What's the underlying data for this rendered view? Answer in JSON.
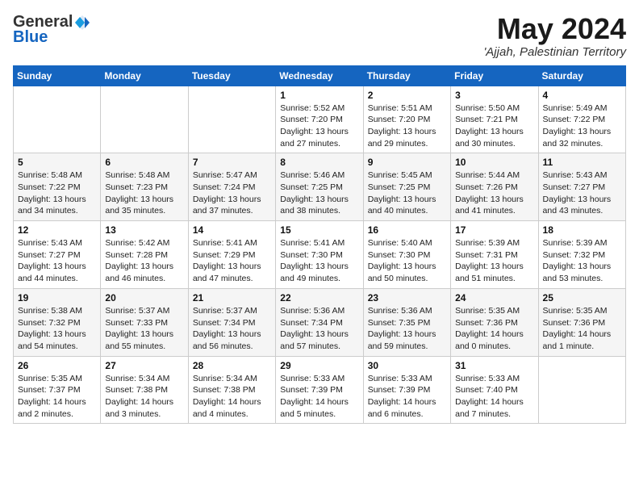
{
  "header": {
    "logo_general": "General",
    "logo_blue": "Blue",
    "month_title": "May 2024",
    "location": "'Ajjah, Palestinian Territory"
  },
  "days_of_week": [
    "Sunday",
    "Monday",
    "Tuesday",
    "Wednesday",
    "Thursday",
    "Friday",
    "Saturday"
  ],
  "weeks": [
    [
      {
        "day": "",
        "info": ""
      },
      {
        "day": "",
        "info": ""
      },
      {
        "day": "",
        "info": ""
      },
      {
        "day": "1",
        "info": "Sunrise: 5:52 AM\nSunset: 7:20 PM\nDaylight: 13 hours\nand 27 minutes."
      },
      {
        "day": "2",
        "info": "Sunrise: 5:51 AM\nSunset: 7:20 PM\nDaylight: 13 hours\nand 29 minutes."
      },
      {
        "day": "3",
        "info": "Sunrise: 5:50 AM\nSunset: 7:21 PM\nDaylight: 13 hours\nand 30 minutes."
      },
      {
        "day": "4",
        "info": "Sunrise: 5:49 AM\nSunset: 7:22 PM\nDaylight: 13 hours\nand 32 minutes."
      }
    ],
    [
      {
        "day": "5",
        "info": "Sunrise: 5:48 AM\nSunset: 7:22 PM\nDaylight: 13 hours\nand 34 minutes."
      },
      {
        "day": "6",
        "info": "Sunrise: 5:48 AM\nSunset: 7:23 PM\nDaylight: 13 hours\nand 35 minutes."
      },
      {
        "day": "7",
        "info": "Sunrise: 5:47 AM\nSunset: 7:24 PM\nDaylight: 13 hours\nand 37 minutes."
      },
      {
        "day": "8",
        "info": "Sunrise: 5:46 AM\nSunset: 7:25 PM\nDaylight: 13 hours\nand 38 minutes."
      },
      {
        "day": "9",
        "info": "Sunrise: 5:45 AM\nSunset: 7:25 PM\nDaylight: 13 hours\nand 40 minutes."
      },
      {
        "day": "10",
        "info": "Sunrise: 5:44 AM\nSunset: 7:26 PM\nDaylight: 13 hours\nand 41 minutes."
      },
      {
        "day": "11",
        "info": "Sunrise: 5:43 AM\nSunset: 7:27 PM\nDaylight: 13 hours\nand 43 minutes."
      }
    ],
    [
      {
        "day": "12",
        "info": "Sunrise: 5:43 AM\nSunset: 7:27 PM\nDaylight: 13 hours\nand 44 minutes."
      },
      {
        "day": "13",
        "info": "Sunrise: 5:42 AM\nSunset: 7:28 PM\nDaylight: 13 hours\nand 46 minutes."
      },
      {
        "day": "14",
        "info": "Sunrise: 5:41 AM\nSunset: 7:29 PM\nDaylight: 13 hours\nand 47 minutes."
      },
      {
        "day": "15",
        "info": "Sunrise: 5:41 AM\nSunset: 7:30 PM\nDaylight: 13 hours\nand 49 minutes."
      },
      {
        "day": "16",
        "info": "Sunrise: 5:40 AM\nSunset: 7:30 PM\nDaylight: 13 hours\nand 50 minutes."
      },
      {
        "day": "17",
        "info": "Sunrise: 5:39 AM\nSunset: 7:31 PM\nDaylight: 13 hours\nand 51 minutes."
      },
      {
        "day": "18",
        "info": "Sunrise: 5:39 AM\nSunset: 7:32 PM\nDaylight: 13 hours\nand 53 minutes."
      }
    ],
    [
      {
        "day": "19",
        "info": "Sunrise: 5:38 AM\nSunset: 7:32 PM\nDaylight: 13 hours\nand 54 minutes."
      },
      {
        "day": "20",
        "info": "Sunrise: 5:37 AM\nSunset: 7:33 PM\nDaylight: 13 hours\nand 55 minutes."
      },
      {
        "day": "21",
        "info": "Sunrise: 5:37 AM\nSunset: 7:34 PM\nDaylight: 13 hours\nand 56 minutes."
      },
      {
        "day": "22",
        "info": "Sunrise: 5:36 AM\nSunset: 7:34 PM\nDaylight: 13 hours\nand 57 minutes."
      },
      {
        "day": "23",
        "info": "Sunrise: 5:36 AM\nSunset: 7:35 PM\nDaylight: 13 hours\nand 59 minutes."
      },
      {
        "day": "24",
        "info": "Sunrise: 5:35 AM\nSunset: 7:36 PM\nDaylight: 14 hours\nand 0 minutes."
      },
      {
        "day": "25",
        "info": "Sunrise: 5:35 AM\nSunset: 7:36 PM\nDaylight: 14 hours\nand 1 minute."
      }
    ],
    [
      {
        "day": "26",
        "info": "Sunrise: 5:35 AM\nSunset: 7:37 PM\nDaylight: 14 hours\nand 2 minutes."
      },
      {
        "day": "27",
        "info": "Sunrise: 5:34 AM\nSunset: 7:38 PM\nDaylight: 14 hours\nand 3 minutes."
      },
      {
        "day": "28",
        "info": "Sunrise: 5:34 AM\nSunset: 7:38 PM\nDaylight: 14 hours\nand 4 minutes."
      },
      {
        "day": "29",
        "info": "Sunrise: 5:33 AM\nSunset: 7:39 PM\nDaylight: 14 hours\nand 5 minutes."
      },
      {
        "day": "30",
        "info": "Sunrise: 5:33 AM\nSunset: 7:39 PM\nDaylight: 14 hours\nand 6 minutes."
      },
      {
        "day": "31",
        "info": "Sunrise: 5:33 AM\nSunset: 7:40 PM\nDaylight: 14 hours\nand 7 minutes."
      },
      {
        "day": "",
        "info": ""
      }
    ]
  ]
}
